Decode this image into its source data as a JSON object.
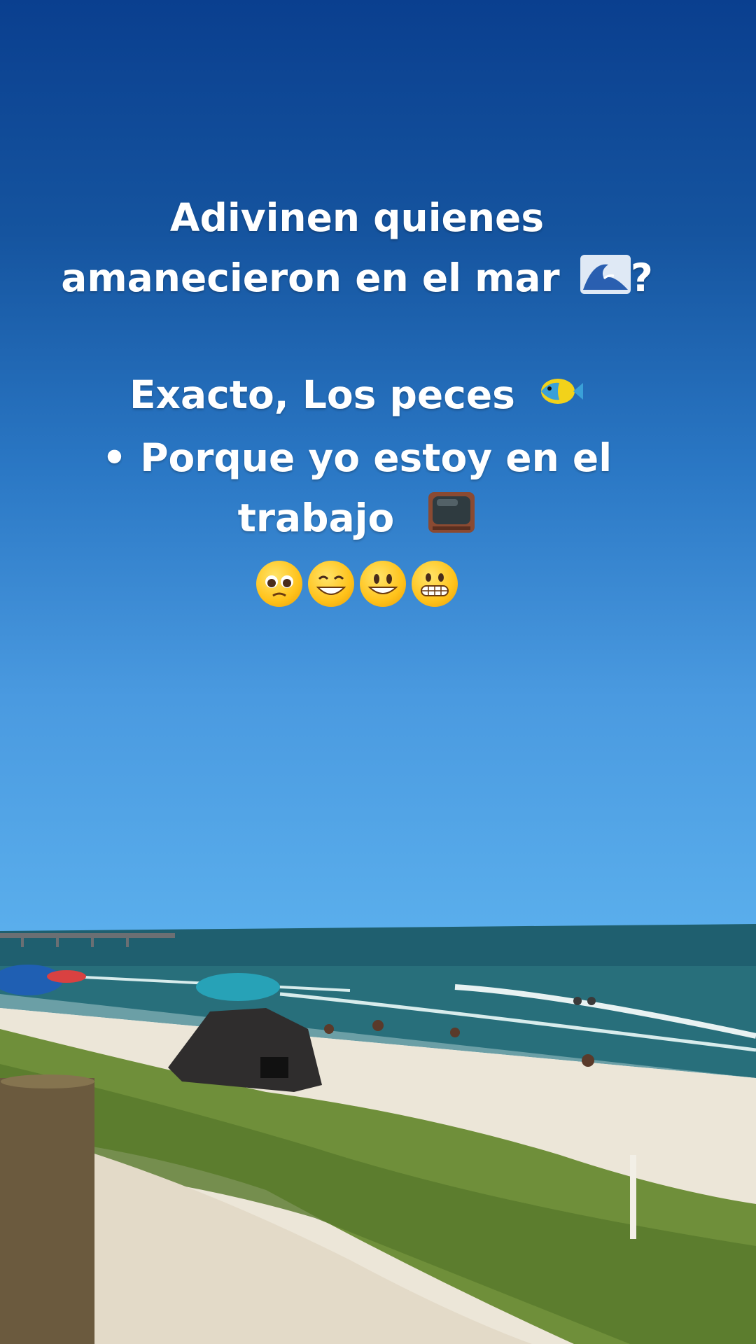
{
  "caption": {
    "line1": "Adivinen quienes",
    "line2": "amanecieron en el mar",
    "line2_end": "?",
    "line3": "Exacto, Los peces",
    "line4": "• Porque yo estoy en el",
    "line5": "trabajo"
  },
  "emojis": [
    "pleading-face",
    "beaming-face",
    "grinning-face",
    "grimacing-face"
  ],
  "icons": [
    "wave-icon",
    "tropical-fish-icon",
    "television-icon"
  ],
  "colors": {
    "sky_top": "#0a3f8f",
    "sky_bottom": "#5aaeec",
    "ocean": "#1f5f6f",
    "sand": "#e9e2d4",
    "grass": "#6f8f3a",
    "caption_text": "#ffffff"
  }
}
